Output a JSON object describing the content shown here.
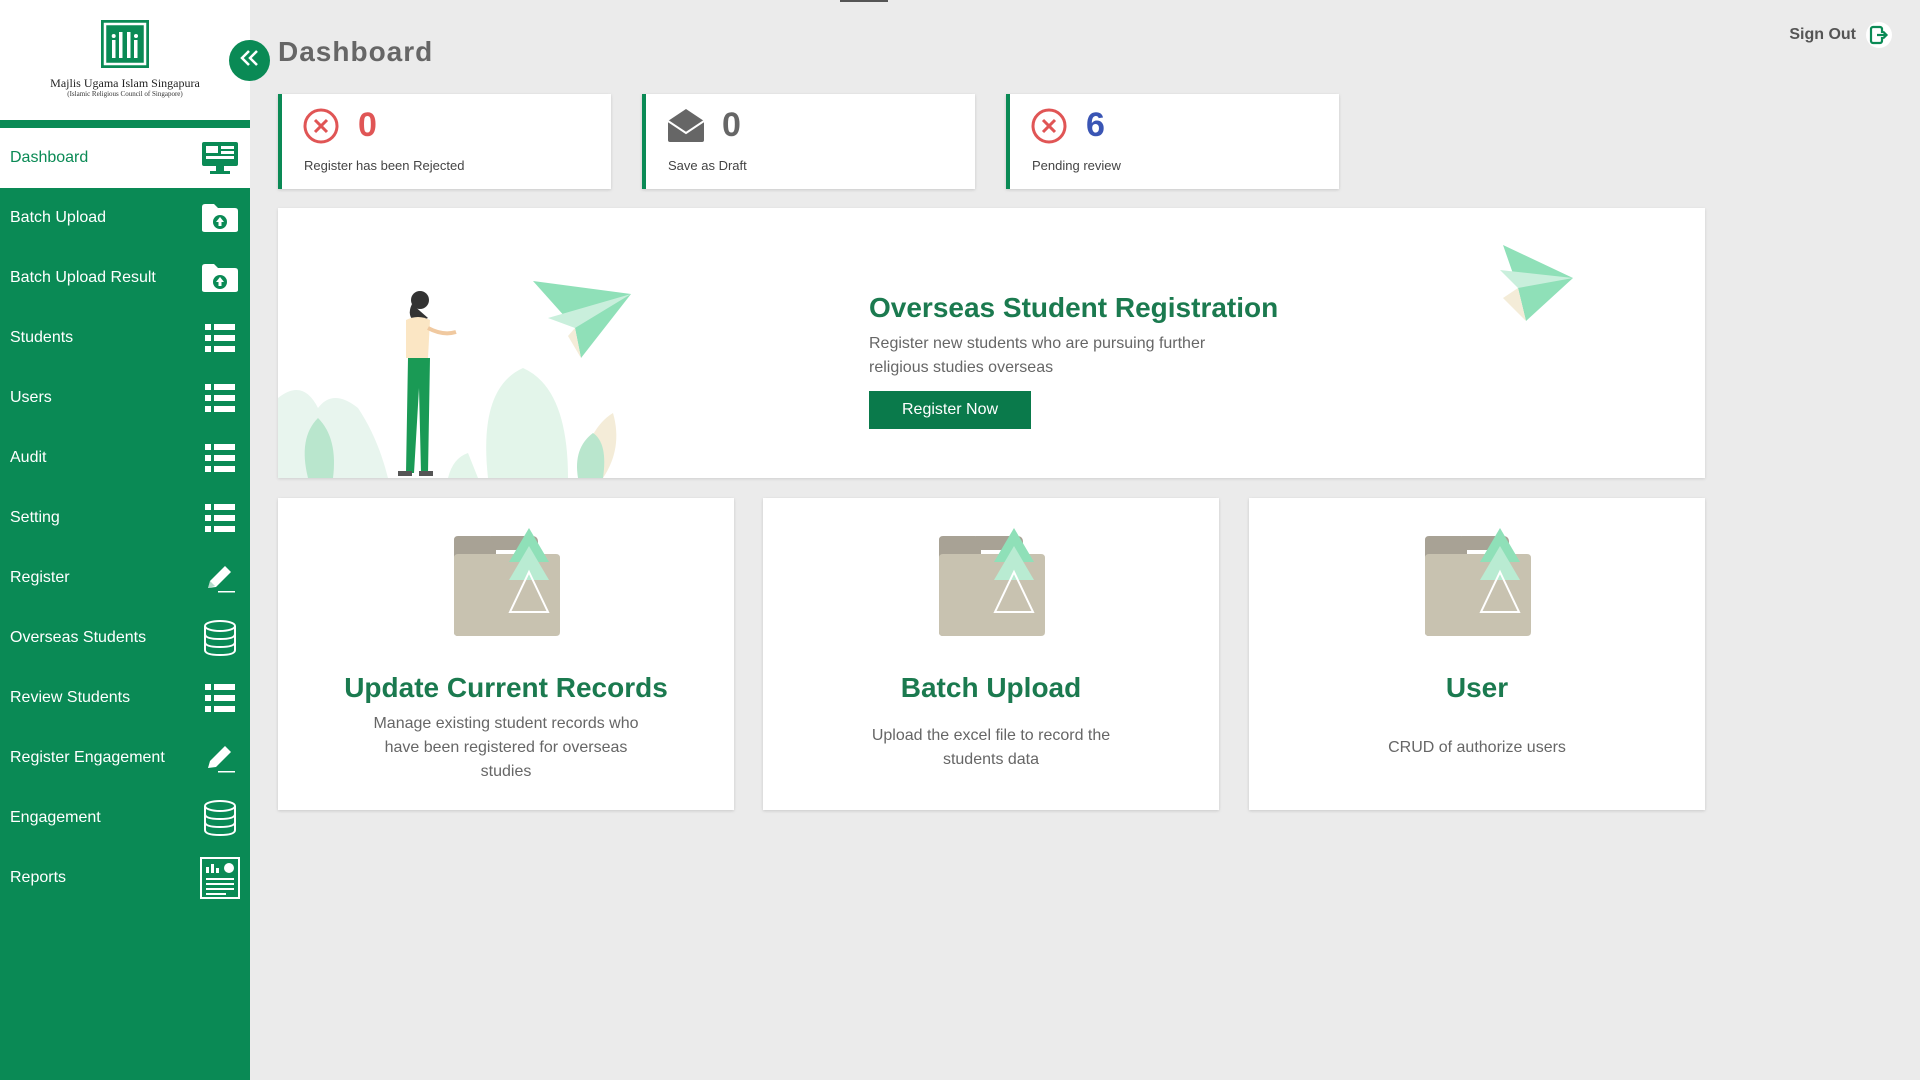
{
  "brand": {
    "name": "Majlis Ugama Islam Singapura",
    "subtitle": "(Islamic Religious Council of Singapore)",
    "color": "#0a8a55"
  },
  "header": {
    "title": "Dashboard",
    "signout_label": "Sign Out"
  },
  "sidebar": {
    "items": [
      {
        "label": "Dashboard",
        "icon": "monitor-icon",
        "active": true
      },
      {
        "label": "Batch Upload",
        "icon": "folder-upload-icon"
      },
      {
        "label": "Batch Upload Result",
        "icon": "folder-upload-icon"
      },
      {
        "label": "Students",
        "icon": "list-icon"
      },
      {
        "label": "Users",
        "icon": "list-icon"
      },
      {
        "label": "Audit",
        "icon": "list-icon"
      },
      {
        "label": "Setting",
        "icon": "list-icon"
      },
      {
        "label": "Register",
        "icon": "pencil-icon"
      },
      {
        "label": "Overseas Students",
        "icon": "database-icon"
      },
      {
        "label": "Review Students",
        "icon": "list-icon"
      },
      {
        "label": "Register Engagement",
        "icon": "pencil-icon"
      },
      {
        "label": "Engagement",
        "icon": "database-icon"
      },
      {
        "label": "Reports",
        "icon": "report-icon"
      }
    ]
  },
  "stats": [
    {
      "value": "0",
      "label": "Register has been Rejected",
      "icon": "x-circle-icon",
      "color": "#e05555"
    },
    {
      "value": "0",
      "label": "Save as Draft",
      "icon": "envelope-open-icon",
      "color": "#666666"
    },
    {
      "value": "6",
      "label": "Pending review",
      "icon": "x-circle-icon",
      "color": "#3a55b4"
    }
  ],
  "banner": {
    "title": "Overseas Student Registration",
    "description": "Register new students who are pursuing further religious studies overseas",
    "button_label": "Register Now"
  },
  "cards": [
    {
      "title": "Update Current Records",
      "description": "Manage existing student records who have been registered for overseas studies",
      "icon": "folder-upload-icon"
    },
    {
      "title": "Batch Upload",
      "description": "Upload the excel file to record the students data",
      "icon": "folder-upload-icon"
    },
    {
      "title": "User",
      "description": "CRUD of authorize users",
      "icon": "folder-upload-icon"
    }
  ]
}
